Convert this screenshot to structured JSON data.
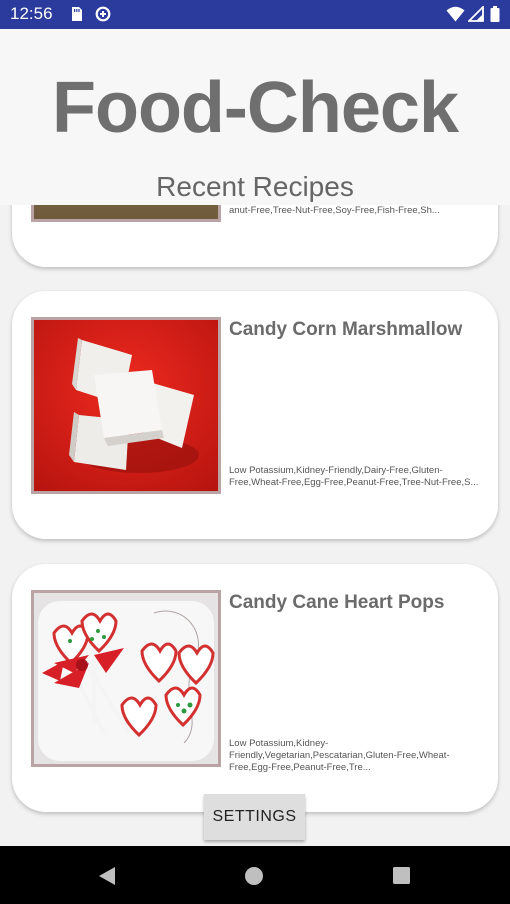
{
  "status_bar": {
    "time": "12:56",
    "icons": [
      "sd-card-icon",
      "data-saver-icon",
      "wifi-icon",
      "signal-icon",
      "battery-icon"
    ]
  },
  "header": {
    "title": "Food-Check",
    "subtitle": "Recent Recipes"
  },
  "recipes": [
    {
      "title": "",
      "tags": "anut-Free,Tree-Nut-Free,Soy-Free,Fish-Free,Sh..."
    },
    {
      "title": "Candy Corn Marshmallow",
      "tags": "Low Potassium,Kidney-Friendly,Dairy-Free,Gluten-Free,Wheat-Free,Egg-Free,Peanut-Free,Tree-Nut-Free,S...",
      "image": "marshmallow-image"
    },
    {
      "title": "Candy Cane Heart Pops",
      "tags": "Low Potassium,Kidney-Friendly,Vegetarian,Pescatarian,Gluten-Free,Wheat-Free,Egg-Free,Peanut-Free,Tre...",
      "image": "heart-pops-image"
    }
  ],
  "settings_button": {
    "label": "SETTINGS"
  },
  "navigation": {
    "icons": [
      "back-icon",
      "home-icon",
      "recents-icon"
    ]
  },
  "colors": {
    "status_bar": "#2a3a9d",
    "title": "#6f6f6f",
    "card_background": "#ffffff",
    "page_background": "#f2f2f2"
  }
}
